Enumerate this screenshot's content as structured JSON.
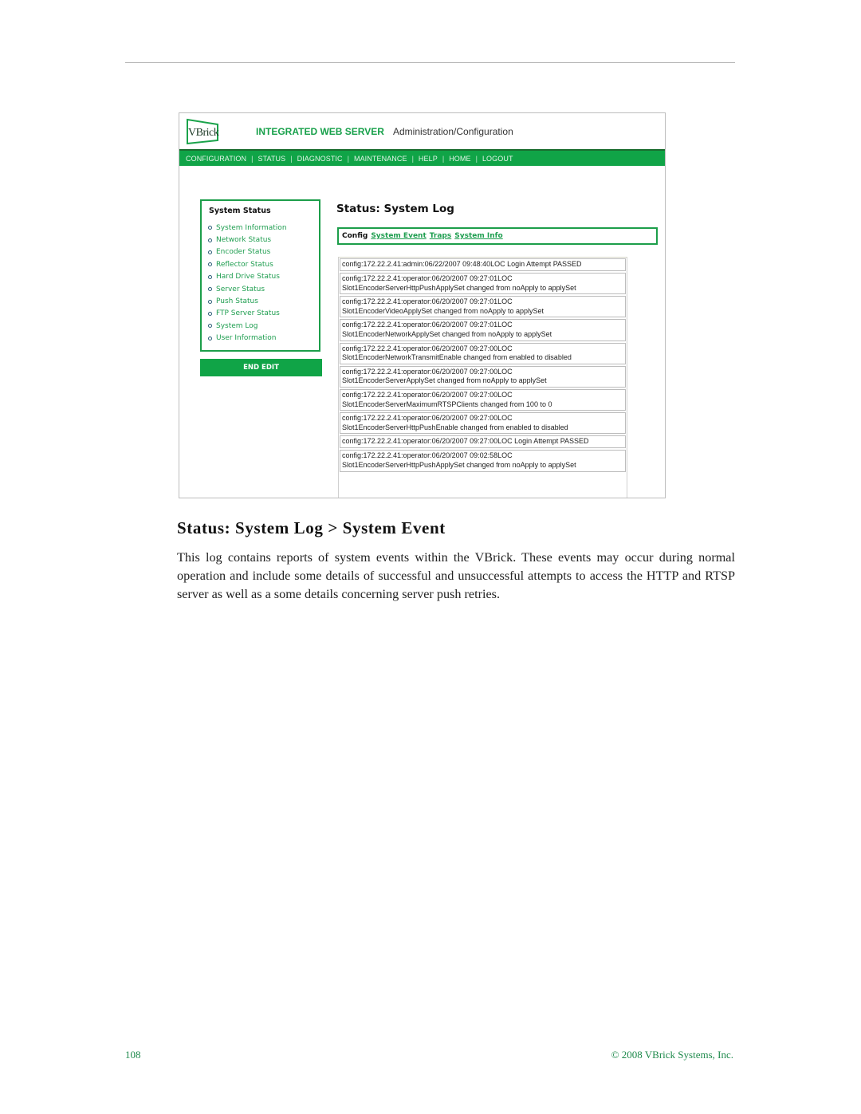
{
  "screenshot": {
    "logo_text": "VBrick",
    "header_title": "INTEGRATED WEB SERVER",
    "header_subtitle": "Administration/Configuration",
    "nav": [
      "CONFIGURATION",
      "STATUS",
      "DIAGNOSTIC",
      "MAINTENANCE",
      "HELP",
      "HOME",
      "LOGOUT"
    ],
    "sidebar": {
      "title": "System Status",
      "items": [
        "System Information",
        "Network Status",
        "Encoder Status",
        "Reflector Status",
        "Hard Drive Status",
        "Server Status",
        "Push Status",
        "FTP Server Status",
        "System Log",
        "User Information"
      ],
      "end_edit_label": "END EDIT"
    },
    "main": {
      "title": "Status: System Log",
      "subnav": {
        "current": "Config",
        "links": [
          "System Event",
          "Traps",
          "System Info"
        ]
      },
      "log_entries": [
        {
          "line1": "config:172.22.2.41:admin:06/22/2007 09:48:40LOC Login Attempt PASSED",
          "line2": ""
        },
        {
          "line1": "config:172.22.2.41:operator:06/20/2007 09:27:01LOC",
          "line2": "Slot1EncoderServerHttpPushApplySet changed from noApply to applySet"
        },
        {
          "line1": "config:172.22.2.41:operator:06/20/2007 09:27:01LOC",
          "line2": "Slot1EncoderVideoApplySet changed from noApply to applySet"
        },
        {
          "line1": "config:172.22.2.41:operator:06/20/2007 09:27:01LOC",
          "line2": "Slot1EncoderNetworkApplySet changed from noApply to applySet"
        },
        {
          "line1": "config:172.22.2.41:operator:06/20/2007 09:27:00LOC",
          "line2": "Slot1EncoderNetworkTransmitEnable changed from enabled to disabled"
        },
        {
          "line1": "config:172.22.2.41:operator:06/20/2007 09:27:00LOC",
          "line2": "Slot1EncoderServerApplySet changed from noApply to applySet"
        },
        {
          "line1": "config:172.22.2.41:operator:06/20/2007 09:27:00LOC",
          "line2": "Slot1EncoderServerMaximumRTSPClients changed from 100 to 0"
        },
        {
          "line1": "config:172.22.2.41:operator:06/20/2007 09:27:00LOC",
          "line2": "Slot1EncoderServerHttpPushEnable changed from enabled to disabled"
        },
        {
          "line1": "config:172.22.2.41:operator:06/20/2007 09:27:00LOC Login Attempt PASSED",
          "line2": ""
        },
        {
          "line1": "config:172.22.2.41:operator:06/20/2007 09:02:58LOC",
          "line2": "Slot1EncoderServerHttpPushApplySet changed from noApply to applySet"
        }
      ]
    }
  },
  "document": {
    "section_title": "Status: System Log > System Event",
    "body": "This log contains reports of system events within the VBrick. These events may occur during normal operation and include some details of successful and unsuccessful attempts to access the HTTP and RTSP server as well as a some details concerning server push retries.",
    "page_number": "108",
    "copyright": "© 2008 VBrick Systems, Inc."
  },
  "colors": {
    "brand_green": "#10a447",
    "link_green": "#1f9e50",
    "footer_green": "#1f8a4c"
  }
}
